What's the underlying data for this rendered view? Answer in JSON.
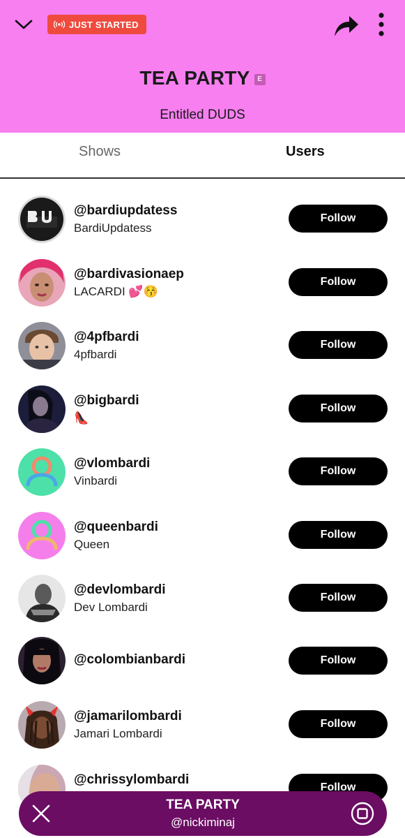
{
  "header": {
    "live_badge": "JUST STARTED",
    "show_title": "TEA PARTY",
    "explicit_label": "E",
    "subtitle": "Entitled DUDS",
    "background": "#f77ff0",
    "badge_color": "#ee4b3e"
  },
  "tabs": {
    "shows": "Shows",
    "users": "Users",
    "active": "Users"
  },
  "users": [
    {
      "username": "@bardiupdatess",
      "display_name": "BardiUpdatess",
      "follow_label": "Follow",
      "avatar": "bu-logo"
    },
    {
      "username": "@bardivasionaep",
      "display_name": "LACARDI 💕😚",
      "follow_label": "Follow",
      "avatar": "photo-pink-hair"
    },
    {
      "username": "@4pfbardi",
      "display_name": "4pfbardi",
      "follow_label": "Follow",
      "avatar": "photo-boy"
    },
    {
      "username": "@bigbardi",
      "display_name": "👠",
      "follow_label": "Follow",
      "avatar": "photo-dark"
    },
    {
      "username": "@vlombardi",
      "display_name": "Vinbardi",
      "follow_label": "Follow",
      "avatar": "default-green"
    },
    {
      "username": "@queenbardi",
      "display_name": "Queen",
      "follow_label": "Follow",
      "avatar": "default-pink"
    },
    {
      "username": "@devlombardi",
      "display_name": "Dev Lombardi",
      "follow_label": "Follow",
      "avatar": "photo-bw"
    },
    {
      "username": "@colombianbardi",
      "display_name": "",
      "follow_label": "Follow",
      "avatar": "photo-dark-hair"
    },
    {
      "username": "@jamarilombardi",
      "display_name": "Jamari Lombardi",
      "follow_label": "Follow",
      "avatar": "photo-horns"
    },
    {
      "username": "@chrissylombardi",
      "display_name": "",
      "follow_label": "Follow",
      "avatar": "photo-face"
    }
  ],
  "mini_player": {
    "title": "TEA PARTY",
    "host": "@nickiminaj",
    "background": "#6b0d63"
  }
}
